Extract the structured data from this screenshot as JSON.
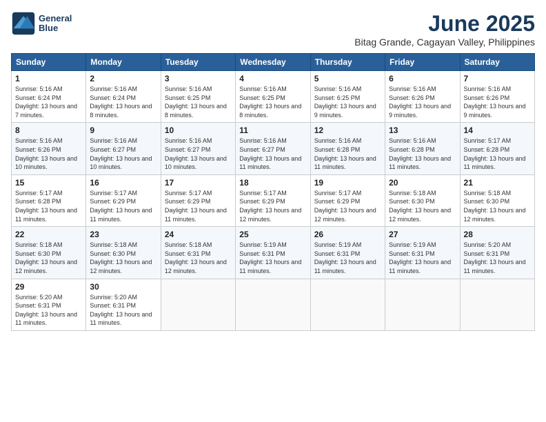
{
  "header": {
    "logo_line1": "General",
    "logo_line2": "Blue",
    "title": "June 2025",
    "subtitle": "Bitag Grande, Cagayan Valley, Philippines"
  },
  "weekdays": [
    "Sunday",
    "Monday",
    "Tuesday",
    "Wednesday",
    "Thursday",
    "Friday",
    "Saturday"
  ],
  "weeks": [
    [
      {
        "day": "1",
        "info": "Sunrise: 5:16 AM\nSunset: 6:24 PM\nDaylight: 13 hours and 7 minutes."
      },
      {
        "day": "2",
        "info": "Sunrise: 5:16 AM\nSunset: 6:24 PM\nDaylight: 13 hours and 8 minutes."
      },
      {
        "day": "3",
        "info": "Sunrise: 5:16 AM\nSunset: 6:25 PM\nDaylight: 13 hours and 8 minutes."
      },
      {
        "day": "4",
        "info": "Sunrise: 5:16 AM\nSunset: 6:25 PM\nDaylight: 13 hours and 8 minutes."
      },
      {
        "day": "5",
        "info": "Sunrise: 5:16 AM\nSunset: 6:25 PM\nDaylight: 13 hours and 9 minutes."
      },
      {
        "day": "6",
        "info": "Sunrise: 5:16 AM\nSunset: 6:26 PM\nDaylight: 13 hours and 9 minutes."
      },
      {
        "day": "7",
        "info": "Sunrise: 5:16 AM\nSunset: 6:26 PM\nDaylight: 13 hours and 9 minutes."
      }
    ],
    [
      {
        "day": "8",
        "info": "Sunrise: 5:16 AM\nSunset: 6:26 PM\nDaylight: 13 hours and 10 minutes."
      },
      {
        "day": "9",
        "info": "Sunrise: 5:16 AM\nSunset: 6:27 PM\nDaylight: 13 hours and 10 minutes."
      },
      {
        "day": "10",
        "info": "Sunrise: 5:16 AM\nSunset: 6:27 PM\nDaylight: 13 hours and 10 minutes."
      },
      {
        "day": "11",
        "info": "Sunrise: 5:16 AM\nSunset: 6:27 PM\nDaylight: 13 hours and 11 minutes."
      },
      {
        "day": "12",
        "info": "Sunrise: 5:16 AM\nSunset: 6:28 PM\nDaylight: 13 hours and 11 minutes."
      },
      {
        "day": "13",
        "info": "Sunrise: 5:16 AM\nSunset: 6:28 PM\nDaylight: 13 hours and 11 minutes."
      },
      {
        "day": "14",
        "info": "Sunrise: 5:17 AM\nSunset: 6:28 PM\nDaylight: 13 hours and 11 minutes."
      }
    ],
    [
      {
        "day": "15",
        "info": "Sunrise: 5:17 AM\nSunset: 6:28 PM\nDaylight: 13 hours and 11 minutes."
      },
      {
        "day": "16",
        "info": "Sunrise: 5:17 AM\nSunset: 6:29 PM\nDaylight: 13 hours and 11 minutes."
      },
      {
        "day": "17",
        "info": "Sunrise: 5:17 AM\nSunset: 6:29 PM\nDaylight: 13 hours and 11 minutes."
      },
      {
        "day": "18",
        "info": "Sunrise: 5:17 AM\nSunset: 6:29 PM\nDaylight: 13 hours and 12 minutes."
      },
      {
        "day": "19",
        "info": "Sunrise: 5:17 AM\nSunset: 6:29 PM\nDaylight: 13 hours and 12 minutes."
      },
      {
        "day": "20",
        "info": "Sunrise: 5:18 AM\nSunset: 6:30 PM\nDaylight: 13 hours and 12 minutes."
      },
      {
        "day": "21",
        "info": "Sunrise: 5:18 AM\nSunset: 6:30 PM\nDaylight: 13 hours and 12 minutes."
      }
    ],
    [
      {
        "day": "22",
        "info": "Sunrise: 5:18 AM\nSunset: 6:30 PM\nDaylight: 13 hours and 12 minutes."
      },
      {
        "day": "23",
        "info": "Sunrise: 5:18 AM\nSunset: 6:30 PM\nDaylight: 13 hours and 12 minutes."
      },
      {
        "day": "24",
        "info": "Sunrise: 5:18 AM\nSunset: 6:31 PM\nDaylight: 13 hours and 12 minutes."
      },
      {
        "day": "25",
        "info": "Sunrise: 5:19 AM\nSunset: 6:31 PM\nDaylight: 13 hours and 11 minutes."
      },
      {
        "day": "26",
        "info": "Sunrise: 5:19 AM\nSunset: 6:31 PM\nDaylight: 13 hours and 11 minutes."
      },
      {
        "day": "27",
        "info": "Sunrise: 5:19 AM\nSunset: 6:31 PM\nDaylight: 13 hours and 11 minutes."
      },
      {
        "day": "28",
        "info": "Sunrise: 5:20 AM\nSunset: 6:31 PM\nDaylight: 13 hours and 11 minutes."
      }
    ],
    [
      {
        "day": "29",
        "info": "Sunrise: 5:20 AM\nSunset: 6:31 PM\nDaylight: 13 hours and 11 minutes."
      },
      {
        "day": "30",
        "info": "Sunrise: 5:20 AM\nSunset: 6:31 PM\nDaylight: 13 hours and 11 minutes."
      },
      {
        "day": "",
        "info": ""
      },
      {
        "day": "",
        "info": ""
      },
      {
        "day": "",
        "info": ""
      },
      {
        "day": "",
        "info": ""
      },
      {
        "day": "",
        "info": ""
      }
    ]
  ]
}
